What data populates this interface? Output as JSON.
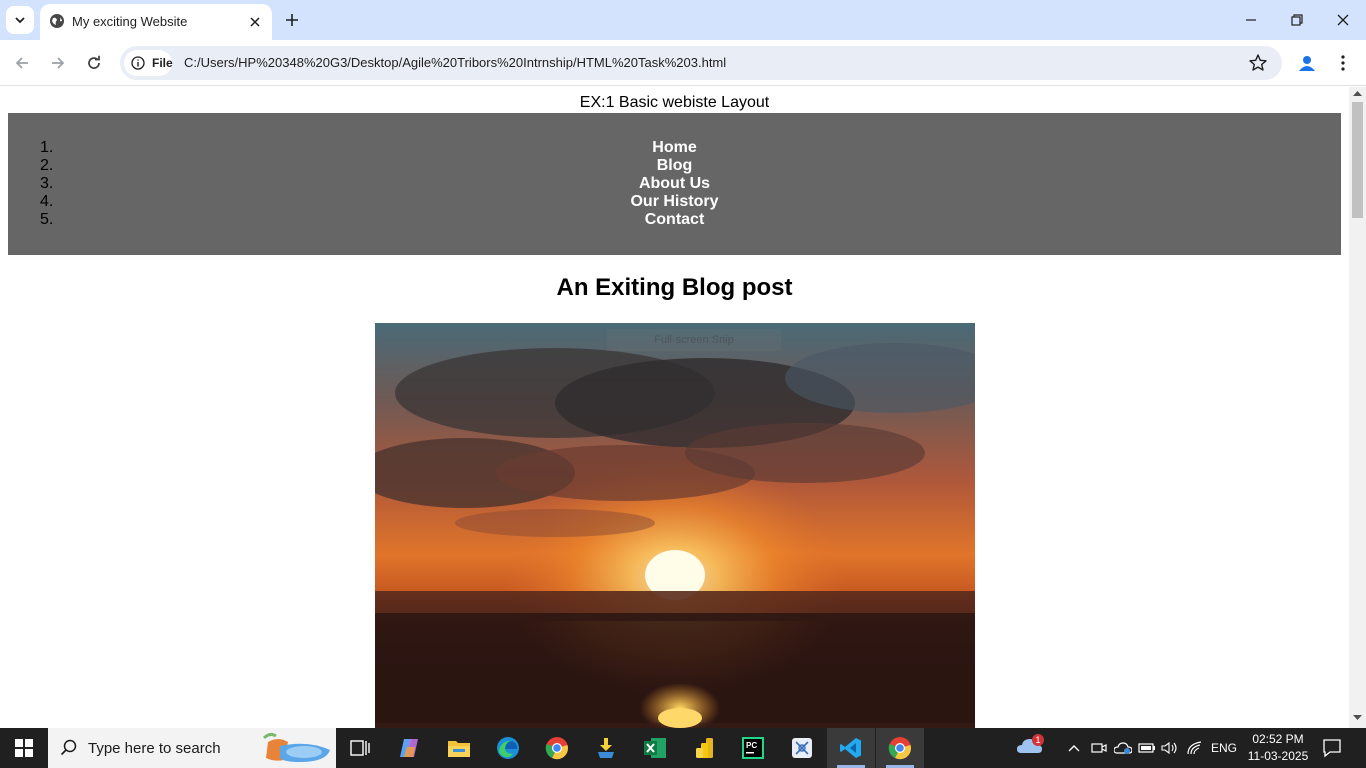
{
  "browser": {
    "tab_title": "My exciting Website",
    "site_chip": "File",
    "url": "C:/Users/HP%20348%20G3/Desktop/Agile%20Tribors%20Intrnship/HTML%20Task%203.html"
  },
  "page": {
    "site_title": "EX:1 Basic webiste Layout",
    "nav": [
      {
        "num": "1.",
        "label": "Home"
      },
      {
        "num": "2.",
        "label": "Blog"
      },
      {
        "num": "3.",
        "label": "About Us"
      },
      {
        "num": "4.",
        "label": "Our History"
      },
      {
        "num": "5.",
        "label": "Contact"
      }
    ],
    "post_title": "An Exiting Blog post",
    "snip_overlay": "Full-screen Snip",
    "colors": {
      "navbar_bg": "#666666",
      "nav_text": "#ffffff"
    }
  },
  "taskbar": {
    "search_placeholder": "Type here to search",
    "apps": [
      "copilot-icon",
      "file-explorer-icon",
      "edge-icon",
      "chrome-icon",
      "app-download-icon",
      "excel-icon",
      "power-bi-icon",
      "pycharm-icon",
      "snipping-icon",
      "vscode-icon",
      "chrome-active-icon"
    ],
    "weather_badge": "1",
    "language": "ENG",
    "time": "02:52 PM",
    "date": "11-03-2025"
  }
}
